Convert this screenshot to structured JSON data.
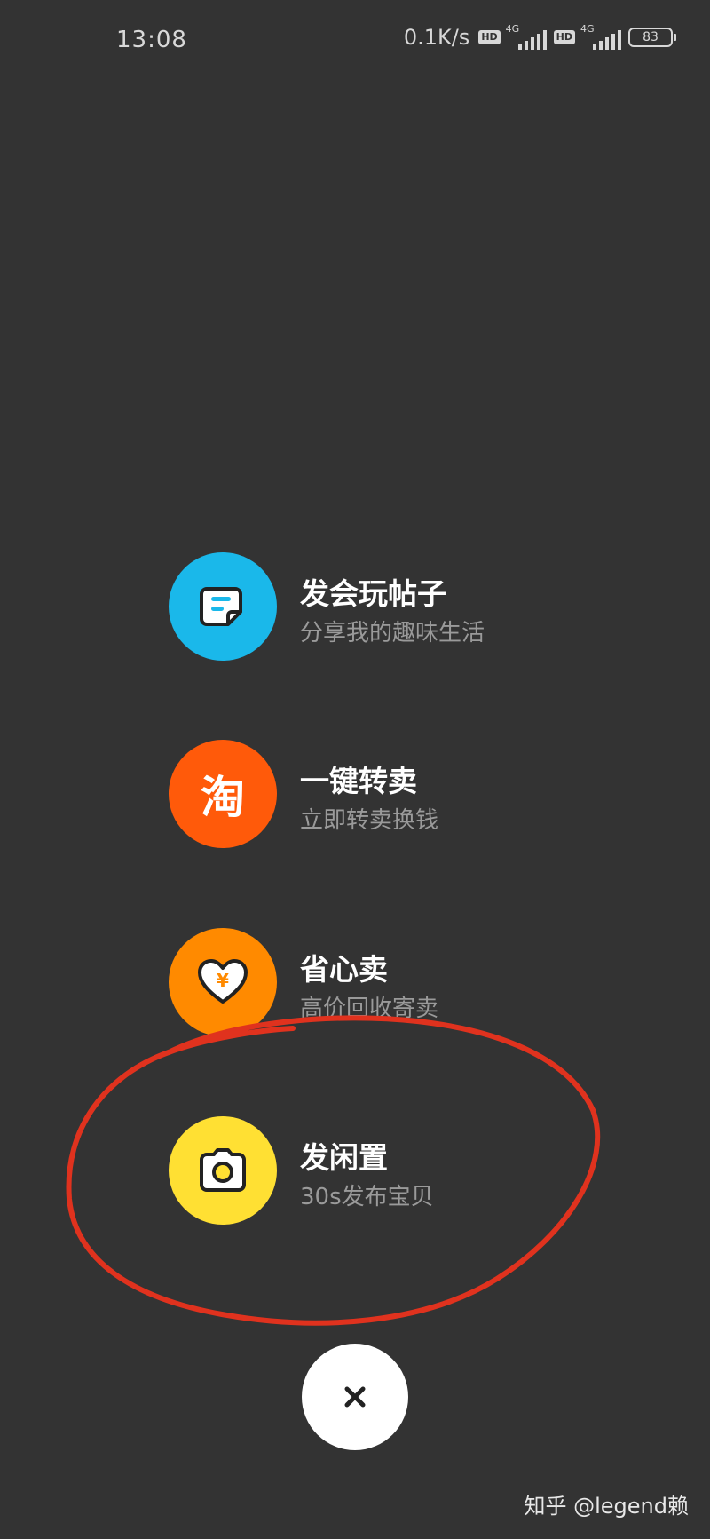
{
  "status_bar": {
    "time": "13:08",
    "net_speed": "0.1K/s",
    "hd_label": "HD",
    "signal_label": "4G",
    "battery": "83"
  },
  "menu": {
    "items": [
      {
        "title": "发会玩帖子",
        "subtitle": "分享我的趣味生活",
        "icon": "note-icon",
        "color": "#1AB8EA"
      },
      {
        "title": "一键转卖",
        "subtitle": "立即转卖换钱",
        "icon": "taobao-icon",
        "icon_text": "淘",
        "color": "#FF5A0A"
      },
      {
        "title": "省心卖",
        "subtitle": "高价回收寄卖",
        "icon": "heart-yen-icon",
        "icon_text": "¥",
        "color": "#FF8A00"
      },
      {
        "title": "发闲置",
        "subtitle": "30s发布宝贝",
        "icon": "camera-icon",
        "color": "#FFE033"
      }
    ]
  },
  "close_button": {
    "icon": "close-icon"
  },
  "watermark": "知乎 @legend赖",
  "annotation_color": "#E0321E"
}
